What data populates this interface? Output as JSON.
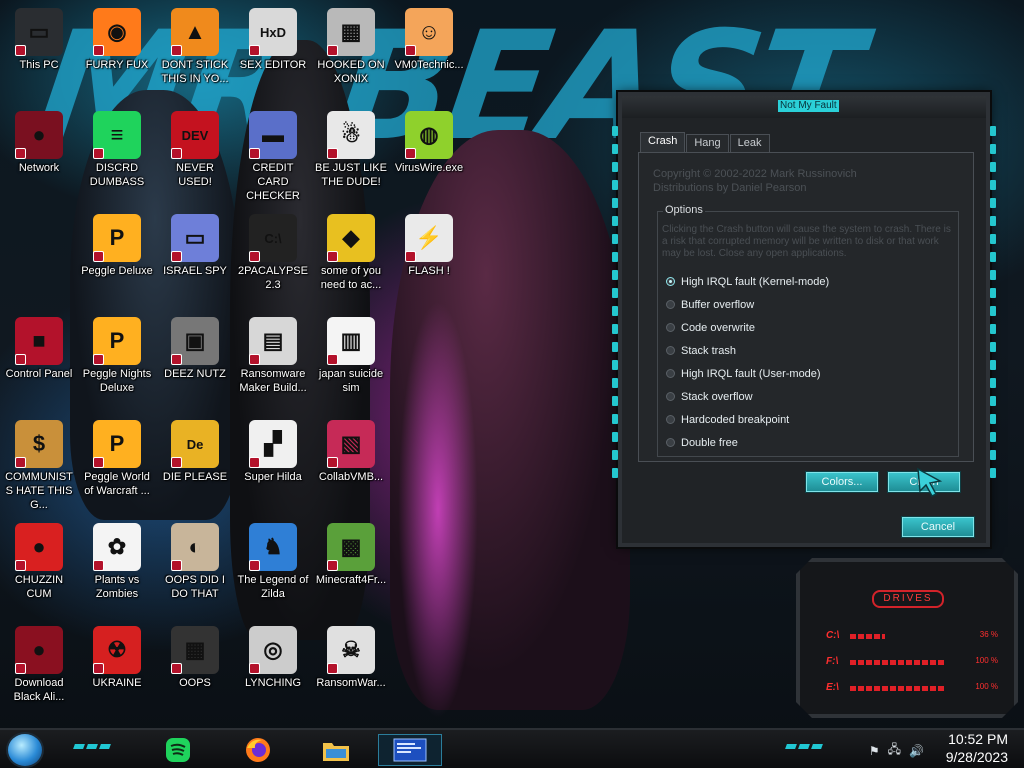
{
  "desktop": {
    "icons": [
      {
        "label": "This PC",
        "icon": "computer-icon"
      },
      {
        "label": "FURRY FUX",
        "icon": "firefox-icon"
      },
      {
        "label": "DONT STICK THIS IN YO...",
        "icon": "vlc-cone-icon"
      },
      {
        "label": "SEX EDITOR",
        "icon": "hex-editor-icon"
      },
      {
        "label": "HOOKED ON XONIX",
        "icon": "xonix-game-icon"
      },
      {
        "label": "VM0Technic...",
        "icon": "doctor-icon"
      },
      {
        "label": "Network",
        "icon": "network-orb-icon"
      },
      {
        "label": "DISCRD DUMBASS",
        "icon": "discord-icon"
      },
      {
        "label": "NEVER USED!",
        "icon": "dev-cpp-icon"
      },
      {
        "label": "CREDIT CARD CHECKER",
        "icon": "credit-card-icon"
      },
      {
        "label": "BE JUST LIKE THE DUDE!",
        "icon": "santa-icon"
      },
      {
        "label": "VirusWire.exe",
        "icon": "lime-icon"
      },
      {
        "label": "Peggle Deluxe",
        "icon": "peggle-icon"
      },
      {
        "label": "ISRAEL SPY",
        "icon": "spy-icon"
      },
      {
        "label": "2PACALYPSE 2.3",
        "icon": "terminal-icon"
      },
      {
        "label": "some of you need to ac...",
        "icon": "beaver-icon"
      },
      {
        "label": "FLASH !",
        "icon": "flash-cards-icon"
      },
      {
        "label": "Control Panel",
        "icon": "control-panel-icon"
      },
      {
        "label": "Peggle Nights Deluxe",
        "icon": "peggle-nights-icon"
      },
      {
        "label": "DEEZ NUTZ",
        "icon": "windows-stack-icon"
      },
      {
        "label": "Ransomware Maker Build...",
        "icon": "ransomware-builder-icon"
      },
      {
        "label": "japan suicide sim",
        "icon": "document-icon"
      },
      {
        "label": "COMMUNISTS HATE THIS G...",
        "icon": "money-bag-icon"
      },
      {
        "label": "Peggle World of Warcraft ...",
        "icon": "peggle-wow-icon"
      },
      {
        "label": "DIE PLEASE",
        "icon": "de-icon"
      },
      {
        "label": "Super Hilda",
        "icon": "dog-pixel-icon"
      },
      {
        "label": "CollabVMB...",
        "icon": "collabvm-icon"
      },
      {
        "label": "CHUZZIN CUM",
        "icon": "chuzzle-icon"
      },
      {
        "label": "Plants vs Zombies",
        "icon": "plants-icon"
      },
      {
        "label": "OOPS DID I DO THAT",
        "icon": "portrait-icon"
      },
      {
        "label": "The Legend of Zilda",
        "icon": "zelda-icon"
      },
      {
        "label": "Minecraft4Fr...",
        "icon": "minecraft-icon"
      },
      {
        "label": "Download Black Ali...",
        "icon": "orb-icon"
      },
      {
        "label": "UKRAINE",
        "icon": "radiation-icon"
      },
      {
        "label": "OOPS",
        "icon": "book-icon"
      },
      {
        "label": "LYNCHING",
        "icon": "knot-icon"
      },
      {
        "label": "RansomWar...",
        "icon": "skull-icon"
      }
    ]
  },
  "dialog": {
    "title": "Not My Fault",
    "tabs": [
      "Crash",
      "Hang",
      "Leak"
    ],
    "active_tab": "Crash",
    "copyright_1": "Copyright © 2002-2022 Mark Russinovich",
    "copyright_2": "Distributions by Daniel Pearson",
    "options_legend": "Options",
    "warning": "Clicking the Crash button will cause the system to crash. There is a risk that corrupted memory will be written to disk or that work may be lost. Close any open applications.",
    "options": [
      {
        "label": "High IRQL fault (Kernel-mode)",
        "selected": true
      },
      {
        "label": "Buffer overflow",
        "selected": false
      },
      {
        "label": "Code overwrite",
        "selected": false
      },
      {
        "label": "Stack trash",
        "selected": false
      },
      {
        "label": "High IRQL fault (User-mode)",
        "selected": false
      },
      {
        "label": "Stack overflow",
        "selected": false
      },
      {
        "label": "Hardcoded breakpoint",
        "selected": false
      },
      {
        "label": "Double free",
        "selected": false
      }
    ],
    "colors_label": "Colors...",
    "crash_label": "Crash",
    "cancel_label": "Cancel"
  },
  "drives_gadget": {
    "title": "DRIVES",
    "drives": [
      {
        "letter": "C:\\",
        "usage": "36 %",
        "fraction": 0.36
      },
      {
        "letter": "F:\\",
        "usage": "100 %",
        "fraction": 1.0
      },
      {
        "letter": "E:\\",
        "usage": "100 %",
        "fraction": 1.0
      }
    ]
  },
  "taskbar": {
    "pinned": [
      "spotify-icon",
      "firefox-icon",
      "file-explorer-icon",
      "dialog-window-icon"
    ],
    "tray_icons": [
      "action-center-flag-icon",
      "network-icon",
      "volume-icon"
    ],
    "time": "10:52 PM",
    "date": "9/28/2023"
  },
  "colors": {
    "accent": "#24c7cf",
    "gadget_red": "#e02027"
  }
}
